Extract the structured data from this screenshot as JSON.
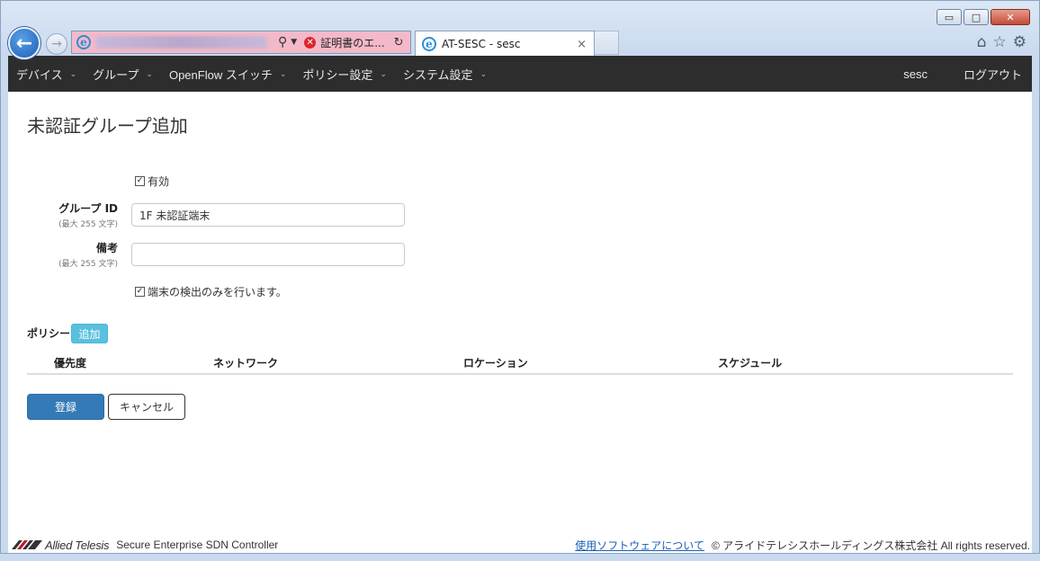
{
  "browser": {
    "window_controls": {
      "minimize": "▭",
      "maximize": "□",
      "close": "✕"
    },
    "address_bar": {
      "cert_error_text": "証明書のエ..."
    },
    "tab": {
      "title": "AT-SESC - sesc",
      "close": "×"
    }
  },
  "navbar": {
    "items": [
      {
        "label": "デバイス"
      },
      {
        "label": "グループ"
      },
      {
        "label": "OpenFlow スイッチ"
      },
      {
        "label": "ポリシー設定"
      },
      {
        "label": "システム設定"
      }
    ],
    "user": "sesc",
    "logout": "ログアウト"
  },
  "page": {
    "title": "未認証グループ追加",
    "enabled_label": "有効",
    "enabled_checked": true,
    "group_id": {
      "label": "グループ ID",
      "hint": "(最大 255 文字)",
      "value": "1F 未認証端末"
    },
    "remarks": {
      "label": "備考",
      "hint": "(最大 255 文字)",
      "value": ""
    },
    "detect_only_label": "端末の検出のみを行います。",
    "detect_only_checked": true,
    "policy": {
      "label": "ポリシー",
      "add_button": "追加",
      "columns": [
        "優先度",
        "ネットワーク",
        "ロケーション",
        "スケジュール"
      ]
    },
    "submit_button": "登録",
    "cancel_button": "キャンセル"
  },
  "footer": {
    "brand": "Allied Telesis",
    "product": "Secure Enterprise SDN Controller",
    "software_link": "使用ソフトウェアについて",
    "copyright": "© アライドテレシスホールディングス株式会社 All rights reserved."
  }
}
